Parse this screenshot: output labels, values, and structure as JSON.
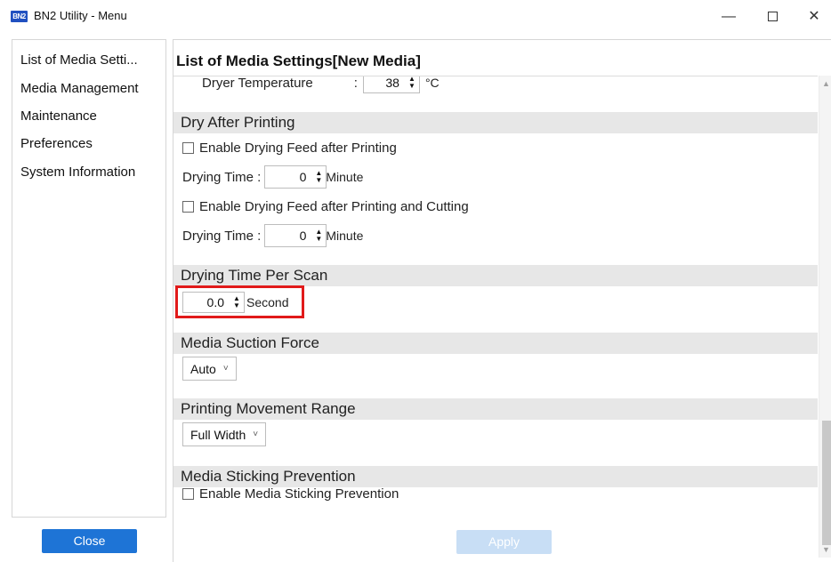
{
  "window": {
    "app_icon_text": "BN2",
    "title": "BN2 Utility - Menu",
    "minimize_glyph": "—",
    "close_glyph": "✕"
  },
  "sidebar": {
    "items": [
      {
        "label": "List of Media Setti..."
      },
      {
        "label": "Media Management"
      },
      {
        "label": "Maintenance"
      },
      {
        "label": "Preferences"
      },
      {
        "label": "System Information"
      }
    ],
    "close_label": "Close"
  },
  "main": {
    "title": "List of Media Settings[New Media]",
    "apply_label": "Apply",
    "dryer_temperature": {
      "label": "Dryer Temperature",
      "separator": ":",
      "value": "38",
      "unit": "°C"
    },
    "dry_after_printing": {
      "header": "Dry After Printing",
      "check1_label": "Enable Drying Feed after Printing",
      "time1_label": "Drying Time :",
      "time1_value": "0",
      "time1_unit": "Minute",
      "check2_label": "Enable Drying Feed after Printing and Cutting",
      "time2_label": "Drying Time :",
      "time2_value": "0",
      "time2_unit": "Minute"
    },
    "drying_time_per_scan": {
      "header": "Drying Time Per Scan",
      "value": "0.0",
      "unit": "Second"
    },
    "media_suction_force": {
      "header": "Media Suction Force",
      "selected": "Auto"
    },
    "printing_movement_range": {
      "header": "Printing Movement Range",
      "selected": "Full Width"
    },
    "media_sticking_prevention": {
      "header": "Media Sticking Prevention",
      "check_label": "Enable Media Sticking Prevention"
    }
  },
  "colors": {
    "accent": "#1e74d6",
    "apply_disabled": "#c8def5",
    "section_header_bg": "#e7e7e7",
    "highlight": "#e11a1a"
  }
}
